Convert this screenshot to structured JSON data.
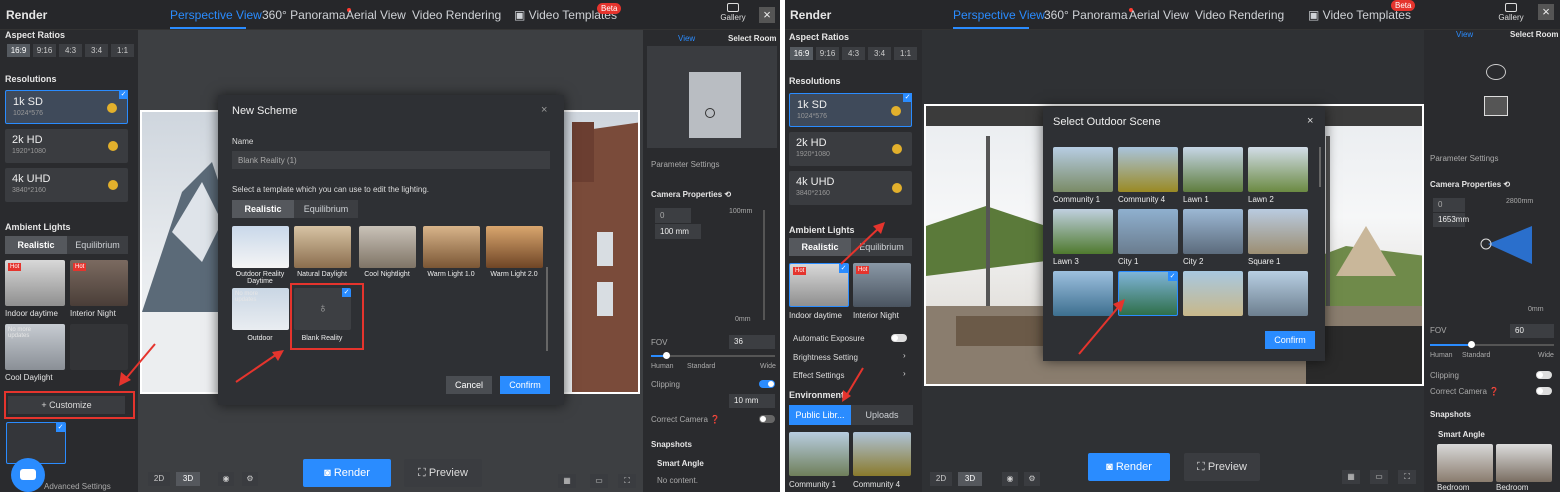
{
  "left": {
    "app_title": "Render",
    "tabs": [
      {
        "label": "Perspective View"
      },
      {
        "label": "360° Panorama"
      },
      {
        "label": "Aerial View"
      },
      {
        "label": "Video Rendering"
      },
      {
        "label": "Video Templates"
      }
    ],
    "beta": "Beta",
    "gallery": "Gallery",
    "aspect_header": "Aspect Ratios",
    "ratios": [
      "16:9",
      "9:16",
      "4:3",
      "3:4",
      "1:1"
    ],
    "resolutions_header": "Resolutions",
    "resolutions": [
      {
        "name": "1k SD",
        "size": "1024*576"
      },
      {
        "name": "2k HD",
        "size": "1920*1080"
      },
      {
        "name": "4k UHD",
        "size": "3840*2160"
      }
    ],
    "ambient_header": "Ambient Lights",
    "ambient_tabs": [
      "Realistic",
      "Equilibrium"
    ],
    "ambient_items": [
      {
        "label": "Indoor daytime",
        "badge": "Hot"
      },
      {
        "label": "Interior Night",
        "badge": "Hot"
      },
      {
        "label": "Cool Daylight",
        "badge": "No more updates"
      }
    ],
    "customize": "Customize",
    "advanced": "Advanced Settings",
    "view_tabs": [
      "View",
      "Select Room"
    ],
    "param_settings": "Parameter Settings",
    "camera_props": "Camera Properties",
    "cam_angle": "0",
    "cam_height": "100",
    "cam_unit": "mm",
    "ruler_top": "100mm",
    "ruler_bottom": "0mm",
    "fov_label": "FOV",
    "fov_value": "36",
    "fov_scale": [
      "Human",
      "Standard",
      "Wide"
    ],
    "clipping": "Clipping",
    "clip_value": "10",
    "clip_unit": "mm",
    "correct_camera": "Correct Camera",
    "snapshots": "Snapshots",
    "smart_angle": "Smart Angle",
    "no_content": "No content.",
    "view_modes": [
      "2D",
      "3D"
    ],
    "render": "Render",
    "preview": "Preview",
    "modal": {
      "title": "New Scheme",
      "close": "×",
      "name_label": "Name",
      "name_value": "Blank Reality (1)",
      "instruction": "Select a template which you can use to edit the lighting.",
      "tabs": [
        "Realistic",
        "Equilibrium"
      ],
      "templates": [
        {
          "label": "Outdoor Reality Daytime"
        },
        {
          "label": "Natural Daylight"
        },
        {
          "label": "Cool Nightlight"
        },
        {
          "label": "Warm Light 1.0"
        },
        {
          "label": "Warm Light 2.0"
        },
        {
          "label": "Outdoor",
          "badge": "No more updates"
        },
        {
          "label": "Blank Reality"
        }
      ],
      "cancel": "Cancel",
      "confirm": "Confirm"
    }
  },
  "right": {
    "app_title": "Render",
    "tabs": [
      {
        "label": "Perspective View"
      },
      {
        "label": "360° Panorama"
      },
      {
        "label": "Aerial View"
      },
      {
        "label": "Video Rendering"
      },
      {
        "label": "Video Templates"
      }
    ],
    "beta": "Beta",
    "gallery": "Gallery",
    "aspect_header": "Aspect Ratios",
    "ratios": [
      "16:9",
      "9:16",
      "4:3",
      "3:4",
      "1:1"
    ],
    "resolutions_header": "Resolutions",
    "resolutions": [
      {
        "name": "1k SD",
        "size": "1024*576"
      },
      {
        "name": "2k HD",
        "size": "1920*1080"
      },
      {
        "name": "4k UHD",
        "size": "3840*2160"
      }
    ],
    "ambient_header": "Ambient Lights",
    "ambient_tabs": [
      "Realistic",
      "Equilibrium"
    ],
    "ambient_items": [
      {
        "label": "Indoor daytime",
        "badge": "Hot"
      },
      {
        "label": "Interior Night",
        "badge": "Hot"
      }
    ],
    "auto_exposure": "Automatic Exposure",
    "brightness": "Brightness Setting",
    "effect": "Effect Settings",
    "environment": "Environment",
    "env_tabs": [
      "Public Libr...",
      "Uploads"
    ],
    "env_items": [
      "Community 1",
      "Community 4"
    ],
    "view_tabs": [
      "View",
      "Select Room"
    ],
    "param_settings": "Parameter Settings",
    "camera_props": "Camera Properties",
    "cam_angle": "0",
    "cam_height": "1653",
    "cam_unit": "mm",
    "ruler_top": "2800mm",
    "ruler_bottom": "0mm",
    "fov_label": "FOV",
    "fov_value": "60",
    "fov_scale": [
      "Human",
      "Standard",
      "Wide"
    ],
    "clipping": "Clipping",
    "correct_camera": "Correct Camera",
    "snapshots": "Snapshots",
    "smart_angle": "Smart Angle",
    "snap_items": [
      "Bedroom",
      "Bedroom"
    ],
    "view_modes": [
      "2D",
      "3D"
    ],
    "render": "Render",
    "preview": "Preview",
    "modal": {
      "title": "Select Outdoor Scene",
      "close": "×",
      "scenes": [
        {
          "label": "Community 1"
        },
        {
          "label": "Community 4"
        },
        {
          "label": "Lawn 1"
        },
        {
          "label": "Lawn 2"
        },
        {
          "label": "Lawn 3"
        },
        {
          "label": "City 1"
        },
        {
          "label": "City 2"
        },
        {
          "label": "Square 1"
        },
        {
          "label": ""
        },
        {
          "label": ""
        },
        {
          "label": ""
        },
        {
          "label": ""
        }
      ],
      "confirm": "Confirm"
    }
  },
  "colors": {
    "accent": "#2a8cff",
    "annotation": "#e5342d",
    "hot": "#e5342d",
    "coin": "#e2b02c"
  }
}
